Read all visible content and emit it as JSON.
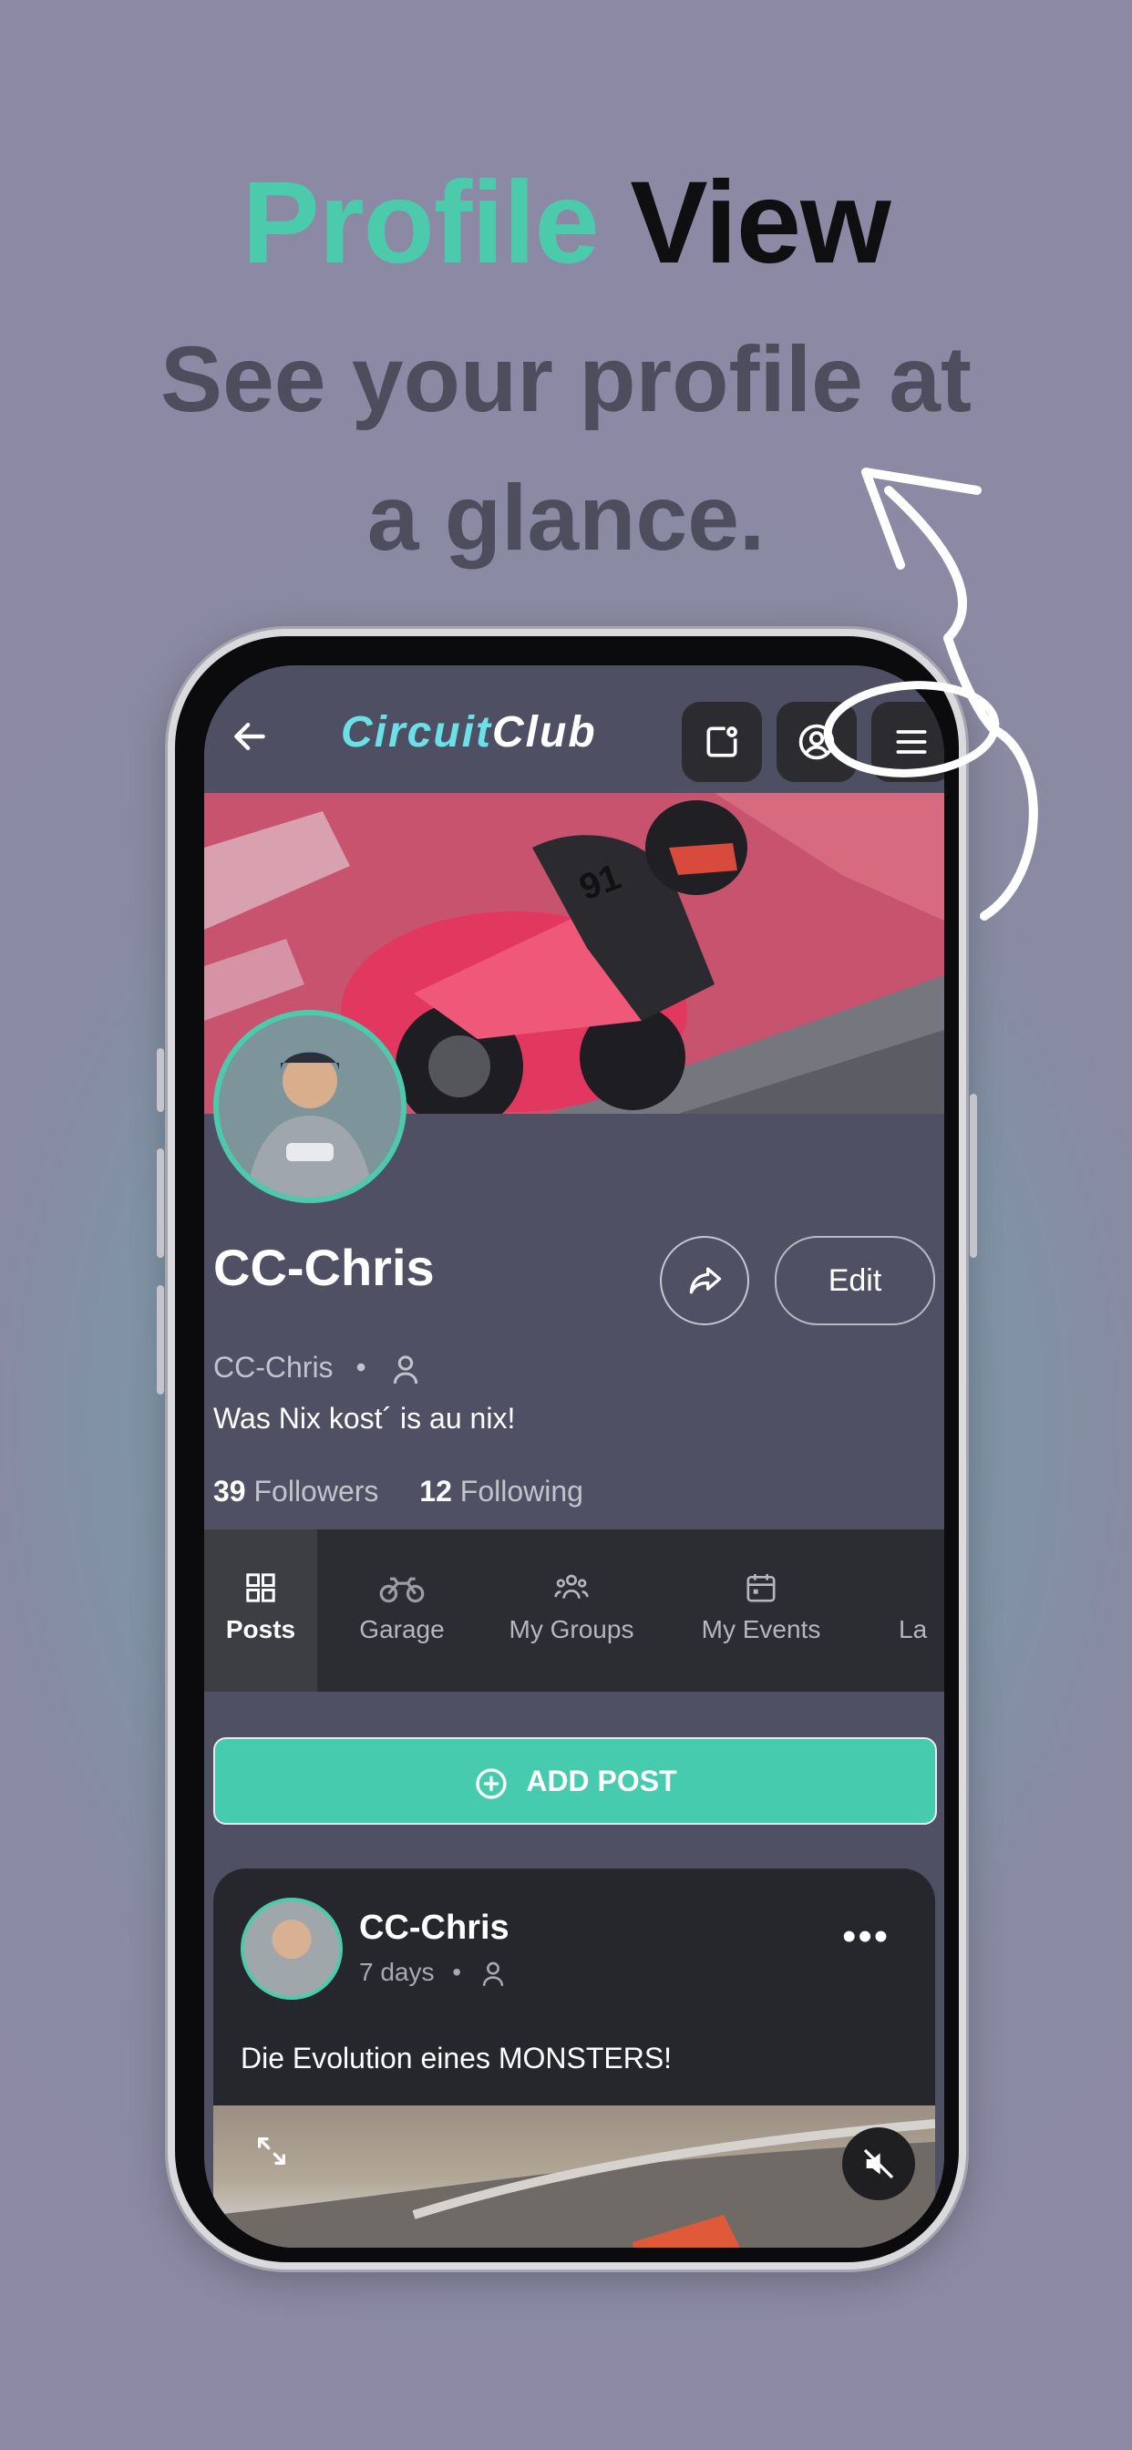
{
  "promo": {
    "title_accent": "Profile",
    "title_rest": "View",
    "subtitle_line1": "See your profile at",
    "subtitle_line2": "a glance."
  },
  "colors": {
    "accent": "#4ccbac",
    "screen_bg": "#505065",
    "tabbar_bg": "#2b2d33",
    "card_bg": "#26272c"
  },
  "topbar": {
    "logo_part1": "Circuit",
    "logo_part2": "Club",
    "icons": [
      "back-arrow-icon",
      "add-content-icon",
      "account-icon",
      "menu-icon"
    ]
  },
  "profile": {
    "name": "CC-Chris",
    "handle": "CC-Chris",
    "separator": "•",
    "bio": "Was Nix kost´ is au nix!",
    "followers_count": "39",
    "followers_label": "Followers",
    "following_count": "12",
    "following_label": "Following",
    "edit_label": "Edit"
  },
  "tabs": [
    {
      "label": "Posts",
      "icon": "grid-icon",
      "active": true
    },
    {
      "label": "Garage",
      "icon": "motorcycle-icon",
      "active": false
    },
    {
      "label": "My Groups",
      "icon": "groups-icon",
      "active": false
    },
    {
      "label": "My Events",
      "icon": "calendar-icon",
      "active": false
    },
    {
      "label": "La",
      "icon": "",
      "active": false
    }
  ],
  "add_post": {
    "label": "ADD POST"
  },
  "post": {
    "author": "CC-Chris",
    "time": "7 days",
    "separator": "•",
    "text": "Die Evolution eines MONSTERS!"
  }
}
